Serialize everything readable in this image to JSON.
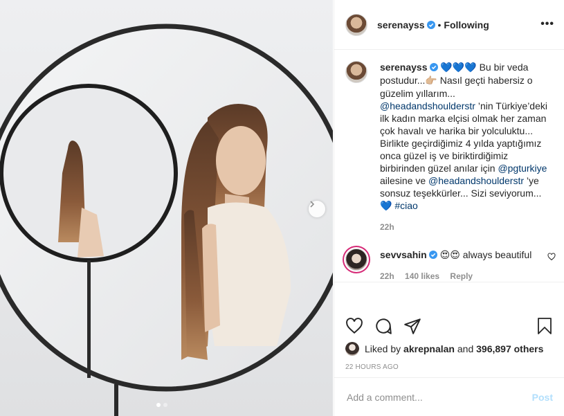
{
  "header": {
    "username": "serenayss",
    "separator": "•",
    "follow_state": "Following",
    "more": "•••"
  },
  "caption": {
    "username": "serenayss",
    "hearts": "💙💙💙",
    "text1": " Bu bir veda postudur...",
    "point": "👉🏼",
    "text2": " Nasıl geçti habersiz o güzelim yıllarım... ",
    "mention1": "@headandshoulderstr",
    "text3": " ’nin Türkiye’deki ilk kadın marka elçisi olmak her zaman çok havalı ve harika bir yolculuktu... Birlikte geçirdiğimiz 4 yılda yaptığımız onca güzel iş ve biriktirdiğimiz birbirinden güzel anılar için ",
    "mention2": "@pgturkiye",
    "text4": " ailesine ve ",
    "mention3": "@headandshoulderstr",
    "text5": " ’ye sonsuz teşekkürler... Sizi seviyorum... ",
    "heart_end": "💙",
    "hashtag": "#ciao",
    "time": "22h"
  },
  "reply": {
    "username": "sevvsahin",
    "emojis": "😍😍",
    "text": " always beautiful",
    "time": "22h",
    "likes": "140 likes",
    "reply_label": "Reply"
  },
  "likes": {
    "prefix": "Liked by ",
    "user": "akrepnalan",
    "mid": " and ",
    "count": "396,897 others"
  },
  "time_ago": "22 HOURS AGO",
  "comment_box": {
    "placeholder": "Add a comment...",
    "post_label": "Post"
  },
  "colors": {
    "verified": "#3897f0",
    "mention": "#00376b",
    "post_disabled": "#b2dffc"
  },
  "icons": {
    "like": "heart-icon",
    "comment": "comment-icon",
    "share": "paper-plane-icon",
    "save": "bookmark-icon",
    "next": "chevron-right-icon"
  }
}
